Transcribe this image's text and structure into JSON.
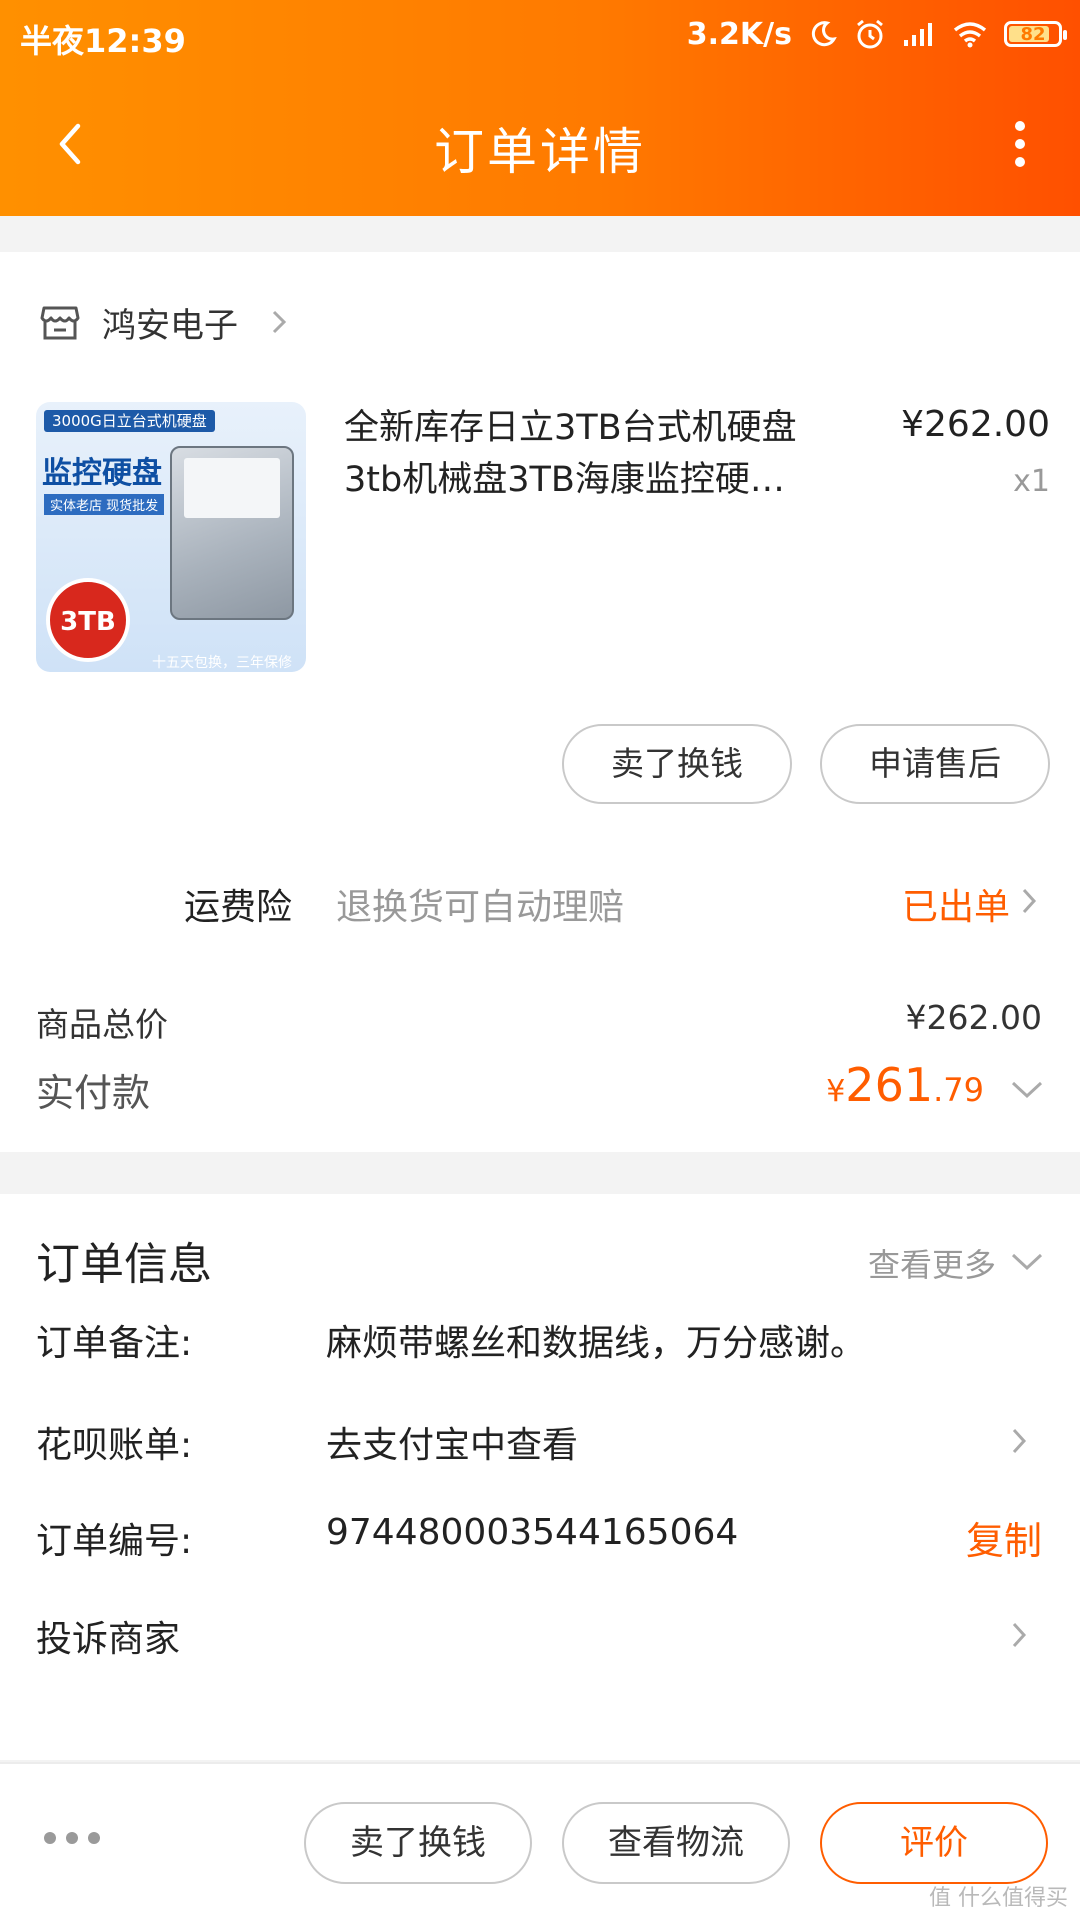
{
  "status_bar": {
    "time": "半夜12:39",
    "speed": "3.2K/s",
    "battery": "82",
    "icons": [
      "moon-icon",
      "alarm-icon",
      "signal-icon",
      "wifi-icon",
      "battery-icon"
    ]
  },
  "nav": {
    "title": "订单详情",
    "back_icon": "chevron-left-icon",
    "more_icon": "more-vertical-icon"
  },
  "shop": {
    "icon": "store-icon",
    "name": "鸿安电子"
  },
  "product": {
    "thumbnail": {
      "header": "3000G日立台式机硬盘",
      "headline": "监控硬盘",
      "tagline": "实体老店 现货批发",
      "badge": "3TB",
      "footer": "十五天包换，三年保修"
    },
    "title_line1": "全新库存日立3TB台式机硬盘",
    "title_line2": "3tb机械盘3TB海康监控硬…",
    "price": "¥262.00",
    "quantity": "x1",
    "actions": {
      "sell": "卖了换钱",
      "after_sale": "申请售后"
    }
  },
  "insurance": {
    "label": "运费险",
    "desc": "退换货可自动理赔",
    "status": "已出单"
  },
  "totals": {
    "goods_label": "商品总价",
    "goods_value": "¥262.00",
    "paid_label": "实付款",
    "paid_currency": "¥",
    "paid_integer": "261",
    "paid_decimal": ".79"
  },
  "order_info": {
    "title": "订单信息",
    "more": "查看更多",
    "remark_label": "订单备注:",
    "remark_value": "麻烦带螺丝和数据线，万分感谢。",
    "huabei_label": "花呗账单:",
    "huabei_value": "去支付宝中查看",
    "number_label": "订单编号:",
    "number_value": "974480003544165064",
    "copy": "复制",
    "complaint_label": "投诉商家"
  },
  "bottom_bar": {
    "sell": "卖了换钱",
    "logistics": "查看物流",
    "review": "评价",
    "watermark": "值 什么值得买"
  },
  "colors": {
    "header_start": "#ff9000",
    "header_end": "#ff5000",
    "accent": "#ff5d00"
  }
}
